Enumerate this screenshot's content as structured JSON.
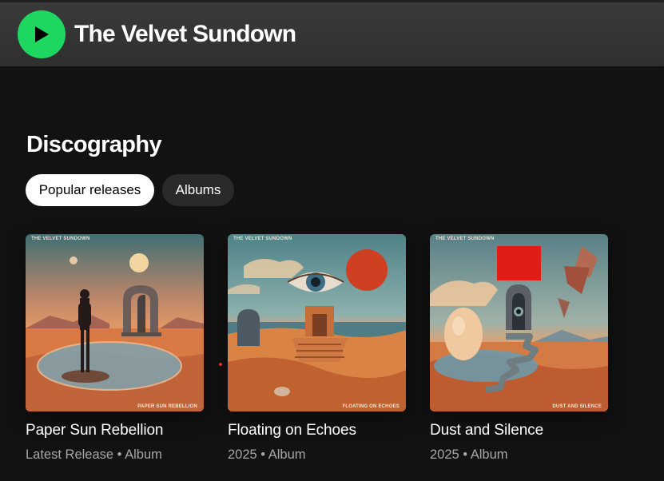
{
  "header": {
    "artist_name": "The Velvet Sundown",
    "accent_color": "#1ed760"
  },
  "discography": {
    "title": "Discography",
    "filters": [
      {
        "label": "Popular releases",
        "selected": true
      },
      {
        "label": "Albums",
        "selected": false
      }
    ],
    "releases": [
      {
        "cover_band": "THE VELVET SUNDOWN",
        "cover_title": "PAPER SUN REBELLION",
        "title": "Paper Sun Rebellion",
        "subtitle": "Latest Release • Album"
      },
      {
        "cover_band": "THE VELVET SUNDOWN",
        "cover_title": "FLOATING ON ECHOES",
        "title": "Floating on Echoes",
        "subtitle": "2025 • Album"
      },
      {
        "cover_band": "THE VELVET SUNDOWN",
        "cover_title": "DUST AND SILENCE",
        "title": "Dust and Silence",
        "subtitle": "2025 • Album"
      }
    ]
  }
}
